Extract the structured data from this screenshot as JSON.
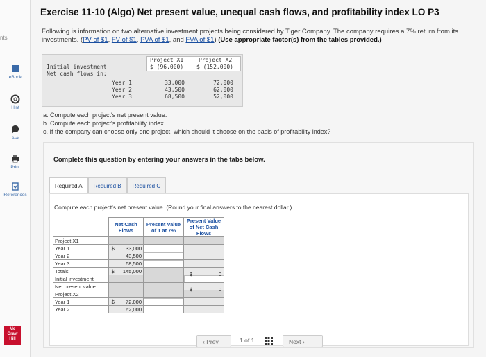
{
  "sidebar": {
    "top_cut": "nts",
    "items": [
      {
        "label": "eBook"
      },
      {
        "label": "Hint"
      },
      {
        "label": "Ask"
      },
      {
        "label": "Print"
      },
      {
        "label": "References"
      }
    ],
    "logo_lines": [
      "Mc",
      "Graw",
      "Hill"
    ]
  },
  "title": "Exercise 11-10 (Algo) Net present value, unequal cash flows, and profitability index LO P3",
  "intro": {
    "text": "Following is information on two alternative investment projects being considered by Tiger Company. The company requires a 7% return from its investments.",
    "links": [
      "PV of $1",
      "FV of $1",
      "PVA of $1",
      "FVA of $1"
    ],
    "note": "(Use appropriate factor(s) from the tables provided.)"
  },
  "investment_table": {
    "col_headers": [
      [
        "Project X1",
        "$ (96,000)"
      ],
      [
        "Project X2",
        "$ (152,000)"
      ]
    ],
    "row_label_1": "Initial investment",
    "row_label_2": "Net cash flows in:",
    "years": [
      "Year 1",
      "Year 2",
      "Year 3"
    ],
    "x1": [
      "33,000",
      "43,500",
      "68,500"
    ],
    "x2": [
      "72,000",
      "62,000",
      "52,000"
    ]
  },
  "tasks": [
    "a. Compute each project's net present value.",
    "b. Compute each project's profitability index.",
    "c. If the company can choose only one project, which should it choose on the basis of profitability index?"
  ],
  "panel": {
    "complete_text": "Complete this question by entering your answers in the tabs below.",
    "tabs": [
      "Required A",
      "Required B",
      "Required C"
    ],
    "instruction": "Compute each project's net present value. (Round your final answers to the nearest dollar.)",
    "grid_headers": [
      "Net Cash Flows",
      "Present Value of 1 at 7%",
      "Present Value of Net Cash Flows"
    ],
    "rows": [
      {
        "label": "Project X1"
      },
      {
        "label": "Year 1",
        "cur": "$",
        "val": "33,000"
      },
      {
        "label": "Year 2",
        "val": "43,500"
      },
      {
        "label": "Year 3",
        "val": "68,500"
      },
      {
        "label": "Totals",
        "cur": "$",
        "val": "145,000",
        "pv_cur": "$",
        "pv_val": "0"
      },
      {
        "label": "Initial investment"
      },
      {
        "label": "Net present value",
        "pv_cur": "$",
        "pv_val": "0"
      },
      {
        "label": "Project X2"
      },
      {
        "label": "Year 1",
        "cur": "$",
        "val": "72,000"
      },
      {
        "label": "Year 2",
        "val": "62,000"
      }
    ],
    "nav": {
      "prev": "Prev",
      "page_current": "1",
      "page_of": "of",
      "page_total": "1",
      "next": "Next"
    }
  }
}
